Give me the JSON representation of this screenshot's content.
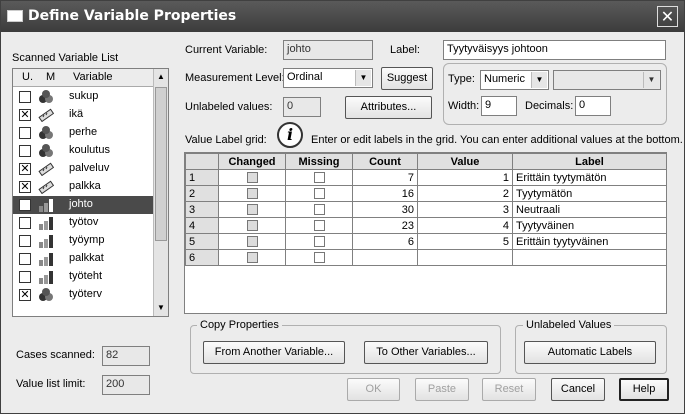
{
  "window": {
    "title": "Define Variable Properties"
  },
  "scanned": {
    "label": "Scanned Variable List",
    "col_u": "U.",
    "col_m": "M",
    "col_var": "Variable",
    "items": [
      {
        "name": "sukup",
        "checked": false,
        "measure": "nominal",
        "selected": false
      },
      {
        "name": "ikä",
        "checked": true,
        "measure": "scale",
        "selected": false
      },
      {
        "name": "perhe",
        "checked": false,
        "measure": "nominal",
        "selected": false
      },
      {
        "name": "koulutus",
        "checked": false,
        "measure": "nominal",
        "selected": false
      },
      {
        "name": "palveluv",
        "checked": true,
        "measure": "scale",
        "selected": false
      },
      {
        "name": "palkka",
        "checked": true,
        "measure": "scale",
        "selected": false
      },
      {
        "name": "johto",
        "checked": false,
        "measure": "ordinal",
        "selected": true
      },
      {
        "name": "työtov",
        "checked": false,
        "measure": "ordinal",
        "selected": false
      },
      {
        "name": "työymp",
        "checked": false,
        "measure": "ordinal",
        "selected": false
      },
      {
        "name": "palkkat",
        "checked": false,
        "measure": "ordinal",
        "selected": false
      },
      {
        "name": "työteht",
        "checked": false,
        "measure": "ordinal",
        "selected": false
      },
      {
        "name": "työterv",
        "checked": true,
        "measure": "nominal",
        "selected": false
      }
    ]
  },
  "cases_scanned": {
    "label": "Cases scanned:",
    "value": "82"
  },
  "value_list_limit": {
    "label": "Value list limit:",
    "value": "200"
  },
  "current_variable": {
    "label": "Current Variable:",
    "value": "johto"
  },
  "label_field": {
    "label": "Label:",
    "value": "Tyytyväisyys johtoon"
  },
  "measurement": {
    "label": "Measurement Level:",
    "value": "Ordinal"
  },
  "suggest_button": "Suggest",
  "type": {
    "label": "Type:",
    "value": "Numeric"
  },
  "unlabeled_values": {
    "label": "Unlabeled values:",
    "value": "0"
  },
  "attributes_button": "Attributes...",
  "width": {
    "label": "Width:",
    "value": "9"
  },
  "decimals": {
    "label": "Decimals:",
    "value": "0"
  },
  "grid": {
    "label": "Value Label grid:",
    "info": "Enter or edit labels in the grid.  You can enter additional values at the bottom.",
    "headers": [
      "Changed",
      "Missing",
      "Count",
      "Value",
      "Label"
    ],
    "rows": [
      {
        "num": "1",
        "count": "7",
        "value": "1",
        "label": "Erittäin tyytymätön"
      },
      {
        "num": "2",
        "count": "16",
        "value": "2",
        "label": "Tyytymätön"
      },
      {
        "num": "3",
        "count": "30",
        "value": "3",
        "label": "Neutraali"
      },
      {
        "num": "4",
        "count": "23",
        "value": "4",
        "label": "Tyytyväinen"
      },
      {
        "num": "5",
        "count": "6",
        "value": "5",
        "label": "Erittäin tyytyväinen"
      },
      {
        "num": "6",
        "count": "",
        "value": "",
        "label": ""
      }
    ]
  },
  "copy_properties": {
    "title": "Copy Properties",
    "from_button": "From Another Variable...",
    "to_button": "To Other Variables..."
  },
  "unlabeled_group": {
    "title": "Unlabeled Values",
    "auto_button": "Automatic Labels"
  },
  "buttons": {
    "ok": "OK",
    "paste": "Paste",
    "reset": "Reset",
    "cancel": "Cancel",
    "help": "Help"
  }
}
